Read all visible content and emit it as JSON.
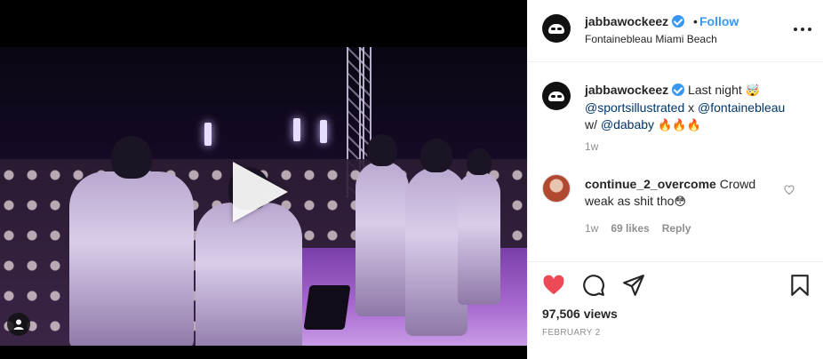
{
  "post": {
    "header": {
      "username": "jabbawockeez",
      "separator": "•",
      "follow_label": "Follow",
      "location": "Fontainebleau Miami Beach"
    },
    "caption": {
      "username": "jabbawockeez",
      "text_1": "Last night",
      "emoji_1": "🤯",
      "mention_1": "@sportsillustrated",
      "x": " x ",
      "mention_2": "@fontainebleau",
      "w": "w/ ",
      "mention_3": "@dababy",
      "emoji_2": " 🔥🔥🔥",
      "time": "1w"
    },
    "comment": {
      "username": "continue_2_overcome",
      "text": " Crowd weak as shit tho",
      "emoji": "😳",
      "time": "1w",
      "likes": "69 likes",
      "reply": "Reply"
    },
    "views": "97,506 views",
    "date": "FEBRUARY 2",
    "colors": {
      "accent": "#3897f0",
      "like_red": "#ed4956",
      "text": "#262626",
      "muted": "#8e8e8e"
    },
    "icons": [
      "verified-badge-icon",
      "more-options-icon",
      "heart-icon",
      "comment-icon",
      "share-icon",
      "bookmark-icon",
      "play-icon",
      "user-tag-icon"
    ]
  }
}
